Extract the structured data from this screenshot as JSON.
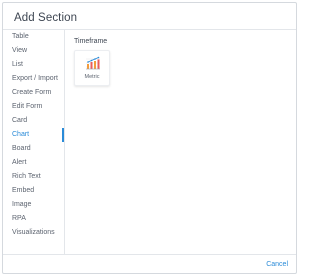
{
  "dialog": {
    "title": "Add Section"
  },
  "sidebar": {
    "items": [
      {
        "label": "Table"
      },
      {
        "label": "View"
      },
      {
        "label": "List"
      },
      {
        "label": "Export / Import"
      },
      {
        "label": "Create Form"
      },
      {
        "label": "Edit Form"
      },
      {
        "label": "Card"
      },
      {
        "label": "Chart"
      },
      {
        "label": "Board"
      },
      {
        "label": "Alert"
      },
      {
        "label": "Rich Text"
      },
      {
        "label": "Embed"
      },
      {
        "label": "Image"
      },
      {
        "label": "RPA"
      },
      {
        "label": "Visualizations"
      }
    ],
    "selected": "Chart"
  },
  "content": {
    "section_title": "Timeframe",
    "cards": [
      {
        "label": "Metric",
        "icon": "metric-chart-icon"
      }
    ]
  },
  "footer": {
    "cancel_label": "Cancel"
  },
  "colors": {
    "accent": "#2a8bd8",
    "text": "#5d6470",
    "border": "#e3e6ea"
  }
}
